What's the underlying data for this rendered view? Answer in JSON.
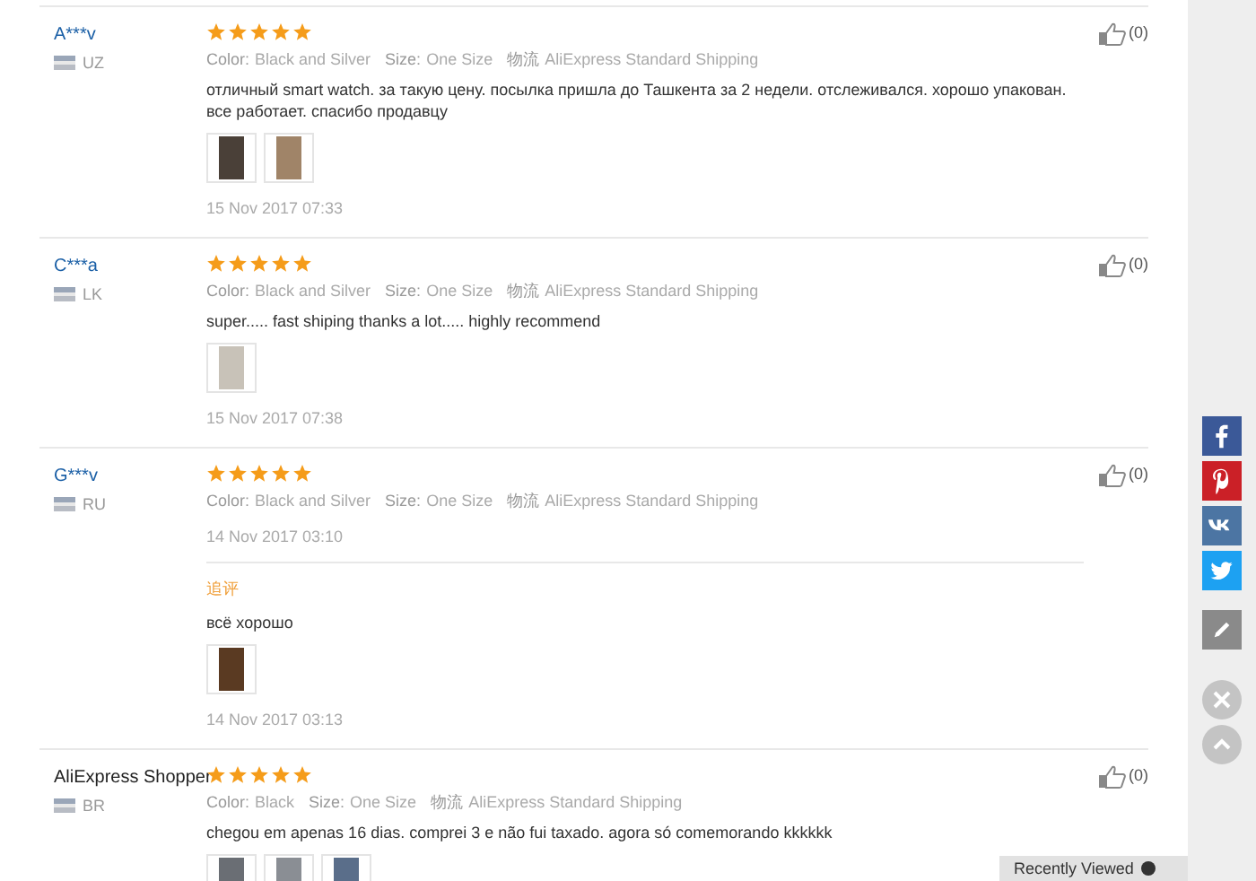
{
  "reviews": [
    {
      "name": "A***v",
      "kind": "masked",
      "country": "UZ",
      "stars": 5,
      "meta": [
        {
          "label": "Color:",
          "value": "Black and Silver"
        },
        {
          "label": "Size:",
          "value": "One Size"
        },
        {
          "label": "物流",
          "value": "AliExpress Standard Shipping"
        }
      ],
      "text": "отличный smart watch. за такую цену. посылка пришла до Ташкента за 2 недели. отслеживался. хорошо упакован. все работает. спасибо продавцу",
      "photos": [
        {
          "color": "#4a4038"
        },
        {
          "color": "#a08468"
        }
      ],
      "date": "15 Nov 2017 07:33",
      "likes": "(0)"
    },
    {
      "name": "C***a",
      "kind": "masked",
      "country": "LK",
      "stars": 5,
      "meta": [
        {
          "label": "Color:",
          "value": "Black and Silver"
        },
        {
          "label": "Size:",
          "value": "One Size"
        },
        {
          "label": "物流",
          "value": "AliExpress Standard Shipping"
        }
      ],
      "text": "super..... fast shiping thanks a lot..... highly recommend",
      "photos": [
        {
          "color": "#c8c2b8"
        }
      ],
      "date": "15 Nov 2017 07:38",
      "likes": "(0)"
    },
    {
      "name": "G***v",
      "kind": "masked",
      "country": "RU",
      "stars": 5,
      "meta": [
        {
          "label": "Color:",
          "value": "Black and Silver"
        },
        {
          "label": "Size:",
          "value": "One Size"
        },
        {
          "label": "物流",
          "value": "AliExpress Standard Shipping"
        }
      ],
      "date": "14 Nov 2017 03:10",
      "likes": "(0)",
      "followup": {
        "label": "追评",
        "text": "всё хорошо",
        "photos": [
          {
            "color": "#5a3a22"
          }
        ],
        "date": "14 Nov 2017 03:13"
      }
    },
    {
      "name": "AliExpress Shopper",
      "kind": "shopper",
      "country": "BR",
      "stars": 5,
      "meta": [
        {
          "label": "Color:",
          "value": "Black"
        },
        {
          "label": "Size:",
          "value": "One Size"
        },
        {
          "label": "物流",
          "value": "AliExpress Standard Shipping"
        }
      ],
      "text": "chegou em apenas 16 dias. comprei 3 e não fui taxado. agora só comemorando kkkkkk",
      "photos": [
        {
          "color": "#6a6e74"
        },
        {
          "color": "#8a8e94"
        },
        {
          "color": "#5a6e8a"
        }
      ],
      "likes": "(0)"
    }
  ],
  "share_buttons": [
    {
      "kind": "facebook",
      "color": "#3b5998"
    },
    {
      "kind": "pinterest",
      "color": "#cb2027"
    },
    {
      "kind": "vk",
      "color": "#4c75a3"
    },
    {
      "kind": "twitter",
      "color": "#1da1f2"
    },
    {
      "kind": "edit",
      "color": "#8a8a8a"
    }
  ],
  "recently_viewed": {
    "label": "Recently Viewed"
  }
}
